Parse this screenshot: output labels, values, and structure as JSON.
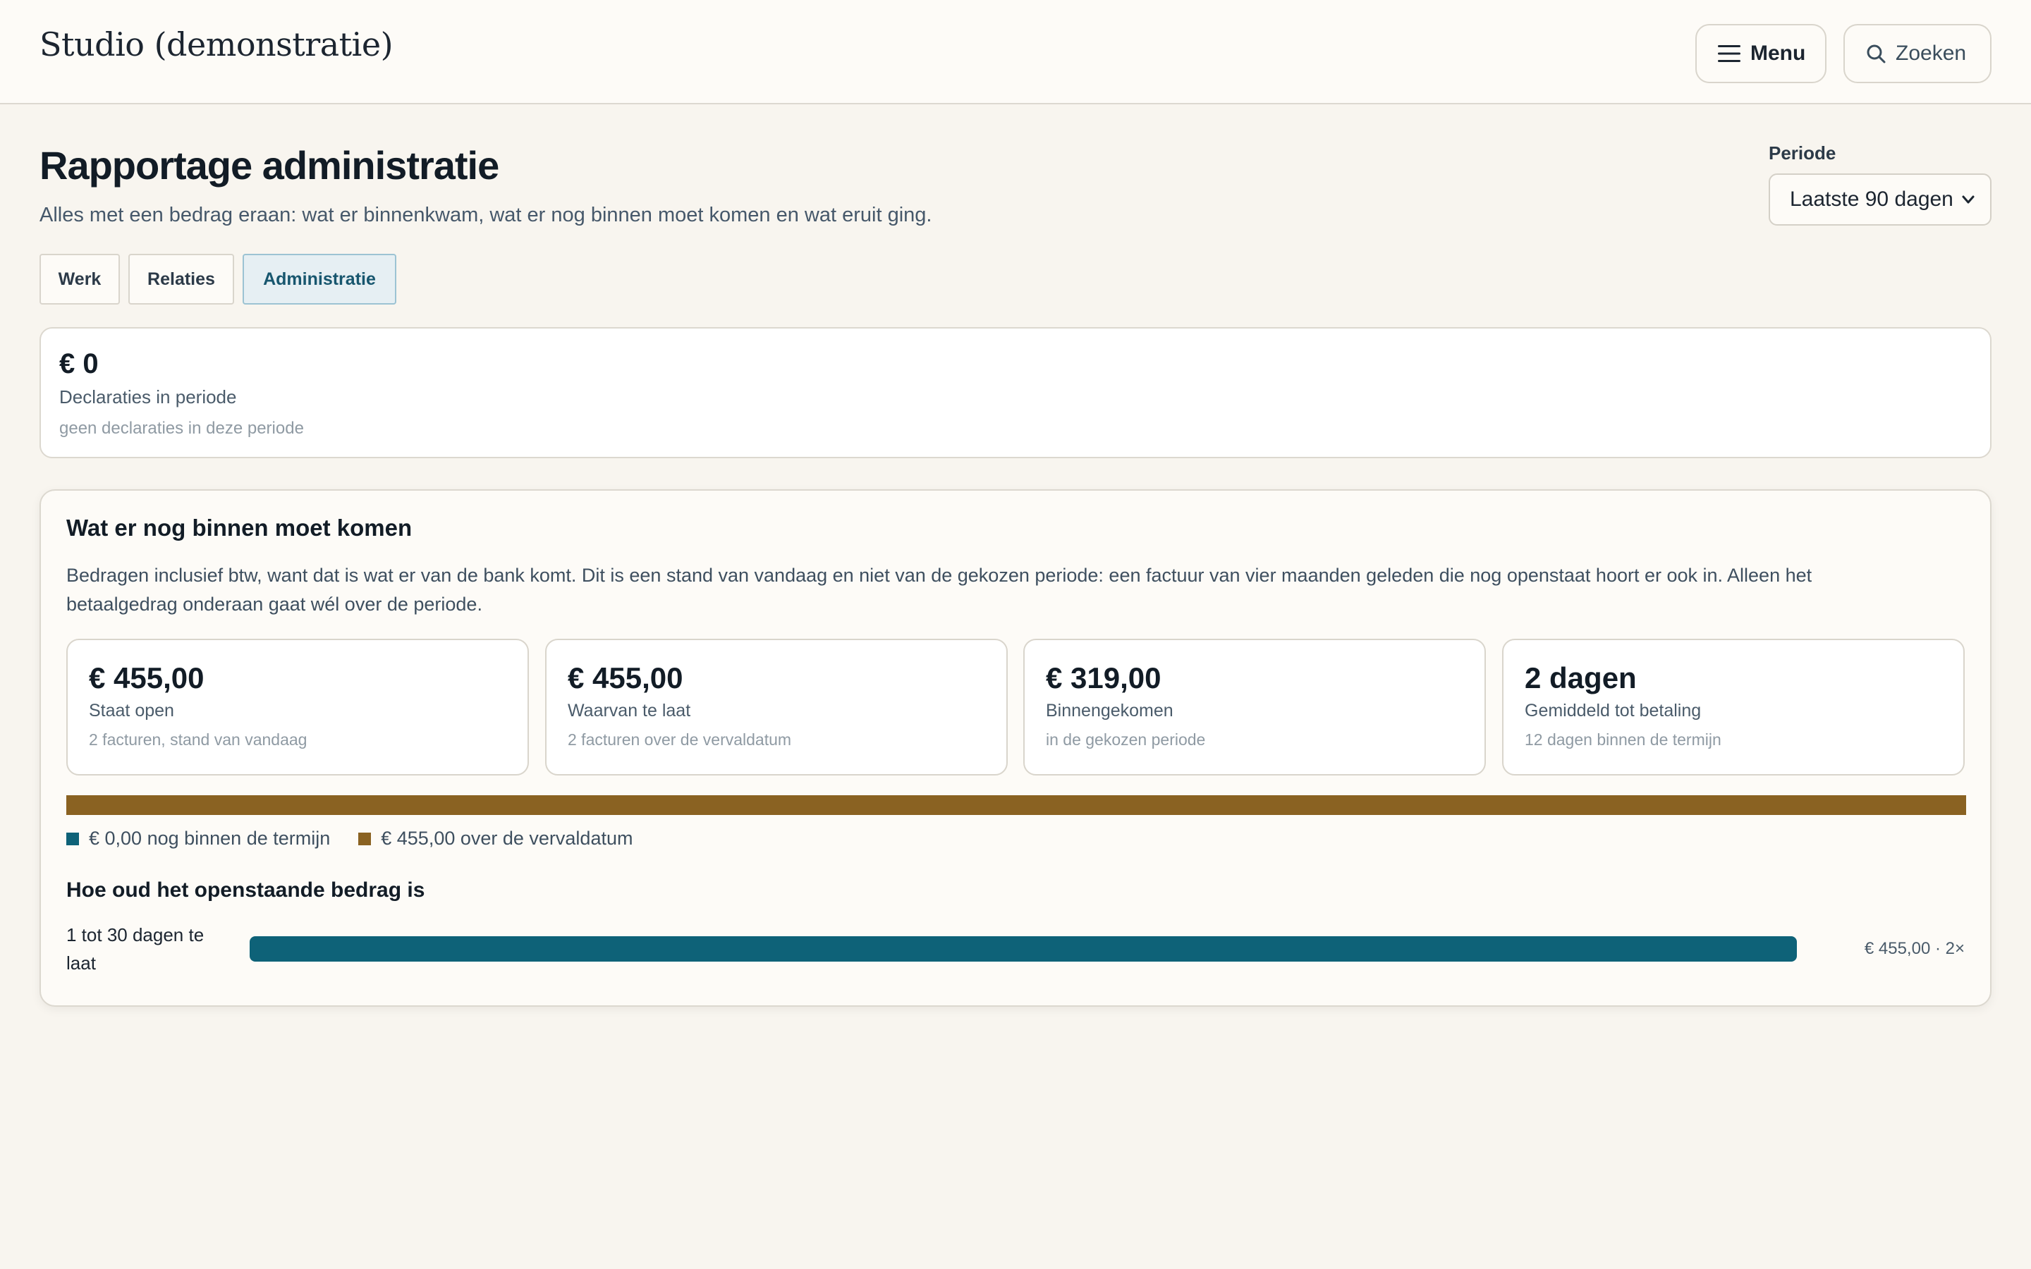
{
  "header": {
    "brand": "Studio (demonstratie)",
    "menu_label": "Menu",
    "search_label": "Zoeken"
  },
  "page": {
    "title": "Rapportage administratie",
    "subtitle": "Alles met een bedrag eraan: wat er binnenkwam, wat er nog binnen moet komen en wat eruit ging.",
    "period_label": "Periode",
    "period_value": "Laatste 90 dagen"
  },
  "tabs": [
    {
      "label": "Werk",
      "active": false
    },
    {
      "label": "Relaties",
      "active": false
    },
    {
      "label": "Administratie",
      "active": true
    }
  ],
  "declaraties": {
    "value": "€ 0",
    "label": "Declaraties in periode",
    "sub": "geen declaraties in deze periode"
  },
  "receivables": {
    "title": "Wat er nog binnen moet komen",
    "intro": "Bedragen inclusief btw, want dat is wat er van de bank komt. Dit is een stand van vandaag en niet van de gekozen periode: een factuur van vier maanden geleden die nog openstaat hoort er ook in. Alleen het betaalgedrag onderaan gaat wél over de periode.",
    "stats": [
      {
        "value": "€ 455,00",
        "label": "Staat open",
        "sub": "2 facturen, stand van vandaag"
      },
      {
        "value": "€ 455,00",
        "label": "Waarvan te laat",
        "sub": "2 facturen over de vervaldatum"
      },
      {
        "value": "€ 319,00",
        "label": "Binnengekomen",
        "sub": "in de gekozen periode"
      },
      {
        "value": "2 dagen",
        "label": "Gemiddeld tot betaling",
        "sub": "12 dagen binnen de termijn"
      }
    ],
    "split": {
      "within_term_amount": 0.0,
      "overdue_amount": 455.0,
      "within_term_color": "#0e6278",
      "overdue_color": "#8a6222"
    },
    "legend": [
      {
        "text": "€ 0,00 nog binnen de termijn",
        "color": "#0e6278"
      },
      {
        "text": "€ 455,00 over de vervaldatum",
        "color": "#8a6222"
      }
    ],
    "aging": {
      "title": "Hoe oud het openstaande bedrag is",
      "rows": [
        {
          "label": "1 tot 30 dagen te laat",
          "value_text": "€ 455,00 · 2×",
          "fraction": 1.0,
          "color": "#0e6278"
        }
      ]
    }
  }
}
